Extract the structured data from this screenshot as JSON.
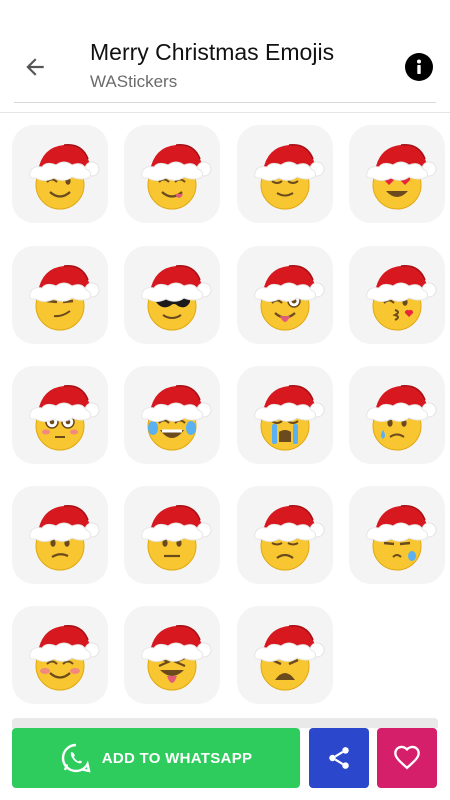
{
  "header": {
    "title": "Merry Christmas Emojis",
    "subtitle": "WAStickers",
    "back_icon": "arrow-back-icon",
    "info_icon": "info-icon"
  },
  "stickers": [
    {
      "name": "wink"
    },
    {
      "name": "yum"
    },
    {
      "name": "relieved"
    },
    {
      "name": "heart-eyes"
    },
    {
      "name": "smirk"
    },
    {
      "name": "sunglasses"
    },
    {
      "name": "zany"
    },
    {
      "name": "kiss"
    },
    {
      "name": "flushed"
    },
    {
      "name": "joy"
    },
    {
      "name": "sob"
    },
    {
      "name": "worried"
    },
    {
      "name": "confused"
    },
    {
      "name": "neutral"
    },
    {
      "name": "disappointed"
    },
    {
      "name": "sleepy"
    },
    {
      "name": "blush"
    },
    {
      "name": "tongue-squint"
    },
    {
      "name": "tired"
    }
  ],
  "actions": {
    "add_label": "ADD TO WHATSAPP",
    "add_color": "#2ecc5c",
    "share_color": "#2b47cc",
    "favorite_color": "#d61f6a"
  }
}
